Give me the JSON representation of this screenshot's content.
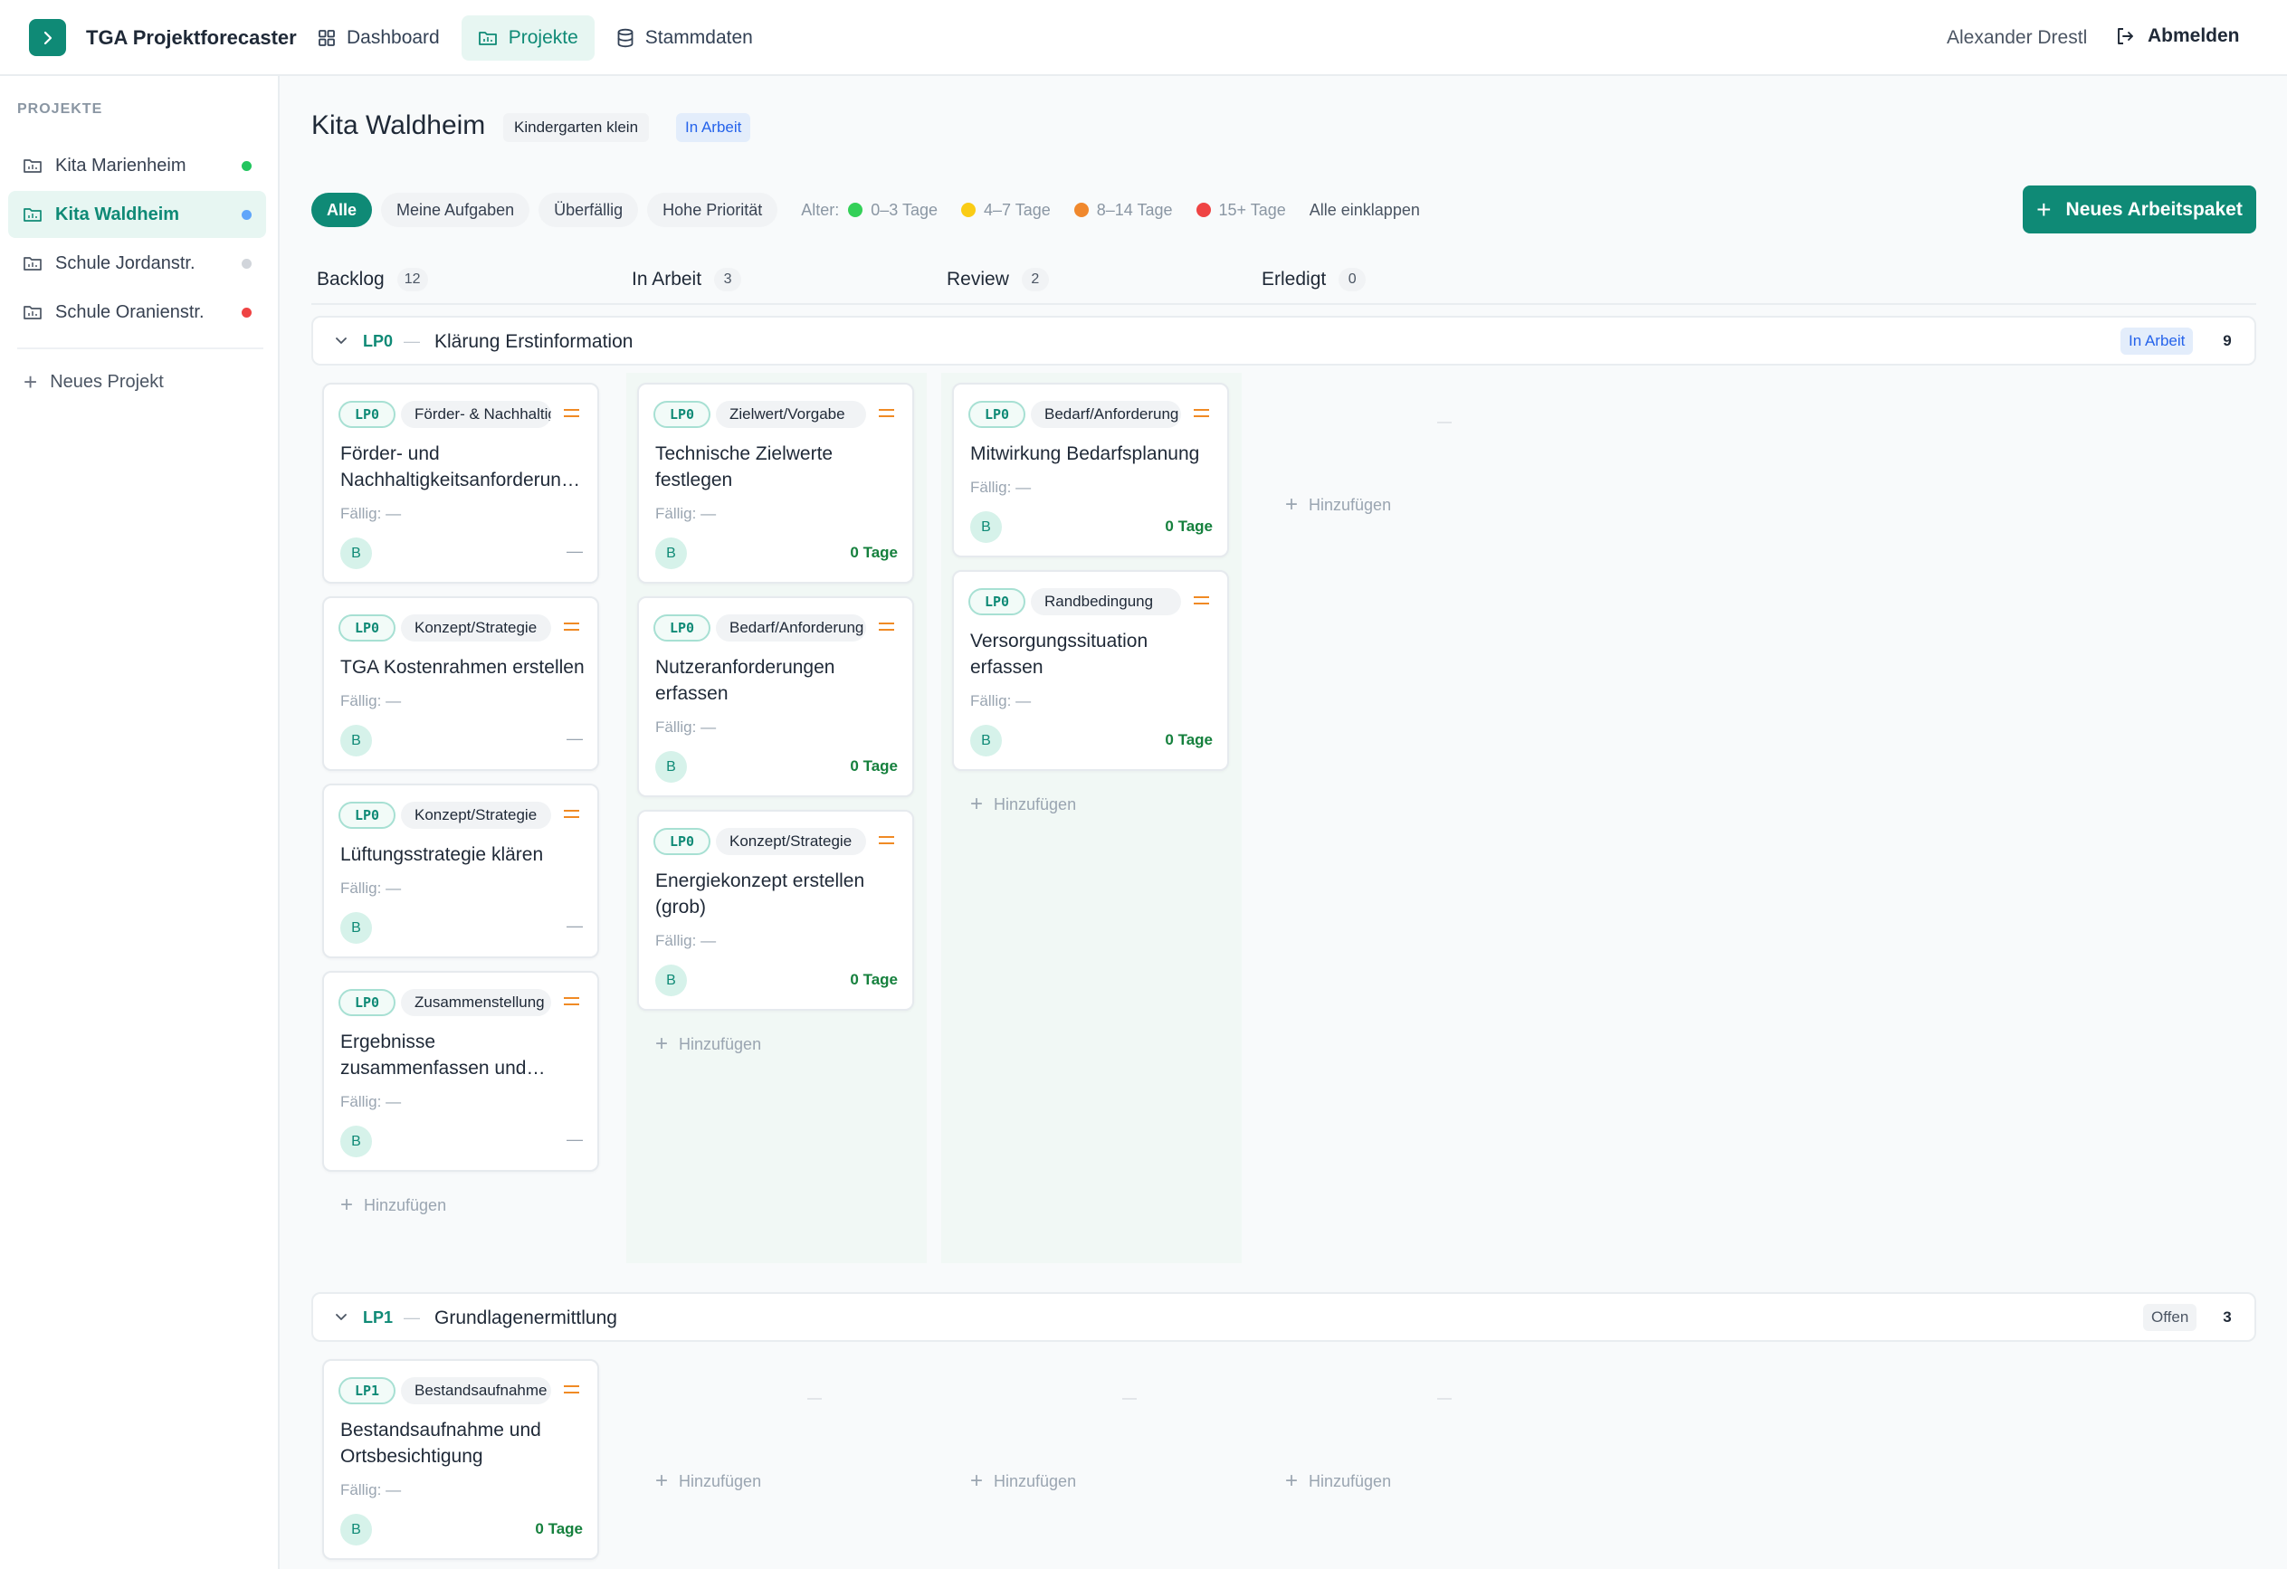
{
  "app": {
    "name": "TGA Projektforecaster",
    "logo_icon": "chevron-right-icon"
  },
  "nav": [
    {
      "label": "Dashboard",
      "icon": "grid-icon",
      "active": false
    },
    {
      "label": "Projekte",
      "icon": "folder-icon",
      "active": true
    },
    {
      "label": "Stammdaten",
      "icon": "database-icon",
      "active": false
    }
  ],
  "user": {
    "name": "Alexander Drestl",
    "logout_label": "Abmelden"
  },
  "sidebar": {
    "heading": "PROJEKTE",
    "items": [
      {
        "label": "Kita Marienheim",
        "dot_color": "#22c55e",
        "active": false
      },
      {
        "label": "Kita Waldheim",
        "dot_color": "#60a5fa",
        "active": true
      },
      {
        "label": "Schule Jordanstr.",
        "dot_color": "#d1d5db",
        "active": false
      },
      {
        "label": "Schule Oranienstr.",
        "dot_color": "#ef4444",
        "active": false
      }
    ],
    "new_project_label": "Neues Projekt"
  },
  "project": {
    "title": "Kita Waldheim",
    "type_badge": "Kindergarten klein",
    "status_badge": "In Arbeit"
  },
  "filters": {
    "pills": [
      "Alle",
      "Meine Aufgaben",
      "Überfällig",
      "Hohe Priorität"
    ],
    "active": "Alle",
    "age_label": "Alter:",
    "age_legend": [
      {
        "label": "0–3 Tage",
        "color": "#34d058"
      },
      {
        "label": "4–7 Tage",
        "color": "#facc15"
      },
      {
        "label": "8–14 Tage",
        "color": "#f0882d"
      },
      {
        "label": "15+ Tage",
        "color": "#ef4444"
      }
    ],
    "collapse_all": "Alle einklappen"
  },
  "new_package_label": "Neues Arbeitspaket",
  "columns": [
    {
      "label": "Backlog",
      "count": "12"
    },
    {
      "label": "In Arbeit",
      "count": "3"
    },
    {
      "label": "Review",
      "count": "2"
    },
    {
      "label": "Erledigt",
      "count": "0"
    }
  ],
  "add_label": "Hinzufügen",
  "empty_marker": "—",
  "groups": [
    {
      "code": "LP0",
      "name": "Klärung Erstinformation",
      "status": "In Arbeit",
      "count": "9",
      "cards": {
        "backlog": [
          {
            "lp": "LP0",
            "category": "Förder- & Nachhaltigkeit",
            "title": "Förder- und Nachhaltigkeitsanforderungen festlegen",
            "due": "Fällig: —",
            "avatar": "B",
            "age": "—",
            "priority": "medium"
          },
          {
            "lp": "LP0",
            "category": "Konzept/Strategie",
            "title": "TGA Kostenrahmen erstellen",
            "due": "Fällig: —",
            "avatar": "B",
            "age": "—",
            "priority": "medium"
          },
          {
            "lp": "LP0",
            "category": "Konzept/Strategie",
            "title": "Lüftungsstrategie klären",
            "due": "Fällig: —",
            "avatar": "B",
            "age": "—",
            "priority": "medium"
          },
          {
            "lp": "LP0",
            "category": "Zusammenstellung",
            "title": "Ergebnisse zusammenfassen und dokumentieren",
            "due": "Fällig: —",
            "avatar": "B",
            "age": "—",
            "priority": "medium"
          }
        ],
        "in_arbeit": [
          {
            "lp": "LP0",
            "category": "Zielwert/Vorgabe",
            "title": "Technische Zielwerte festlegen",
            "due": "Fällig: —",
            "avatar": "B",
            "age": "0 Tage",
            "priority": "medium"
          },
          {
            "lp": "LP0",
            "category": "Bedarf/Anforderung",
            "title": "Nutzeranforderungen erfassen",
            "due": "Fällig: —",
            "avatar": "B",
            "age": "0 Tage",
            "priority": "medium"
          },
          {
            "lp": "LP0",
            "category": "Konzept/Strategie",
            "title": "Energiekonzept erstellen (grob)",
            "due": "Fällig: —",
            "avatar": "B",
            "age": "0 Tage",
            "priority": "medium"
          }
        ],
        "review": [
          {
            "lp": "LP0",
            "category": "Bedarf/Anforderung",
            "title": "Mitwirkung Bedarfsplanung",
            "due": "Fällig: —",
            "avatar": "B",
            "age": "0 Tage",
            "priority": "medium"
          },
          {
            "lp": "LP0",
            "category": "Randbedingung",
            "title": "Versorgungssituation erfassen",
            "due": "Fällig: —",
            "avatar": "B",
            "age": "0 Tage",
            "priority": "medium"
          }
        ],
        "erledigt": []
      }
    },
    {
      "code": "LP1",
      "name": "Grundlagenermittlung",
      "status": "Offen",
      "count": "3",
      "cards": {
        "backlog": [
          {
            "lp": "LP1",
            "category": "Bestandsaufnahme",
            "title": "Bestandsaufnahme und Ortsbesichtigung",
            "due": "Fällig: —",
            "avatar": "B",
            "age": "0 Tage",
            "priority": "medium"
          }
        ],
        "in_arbeit": [],
        "review": [],
        "erledigt": []
      }
    }
  ],
  "colors": {
    "accent": "#0f8a76",
    "lane_bg": "#f1f8f5",
    "priority_medium": "#f08a24",
    "age_fresh": "#15803d"
  }
}
